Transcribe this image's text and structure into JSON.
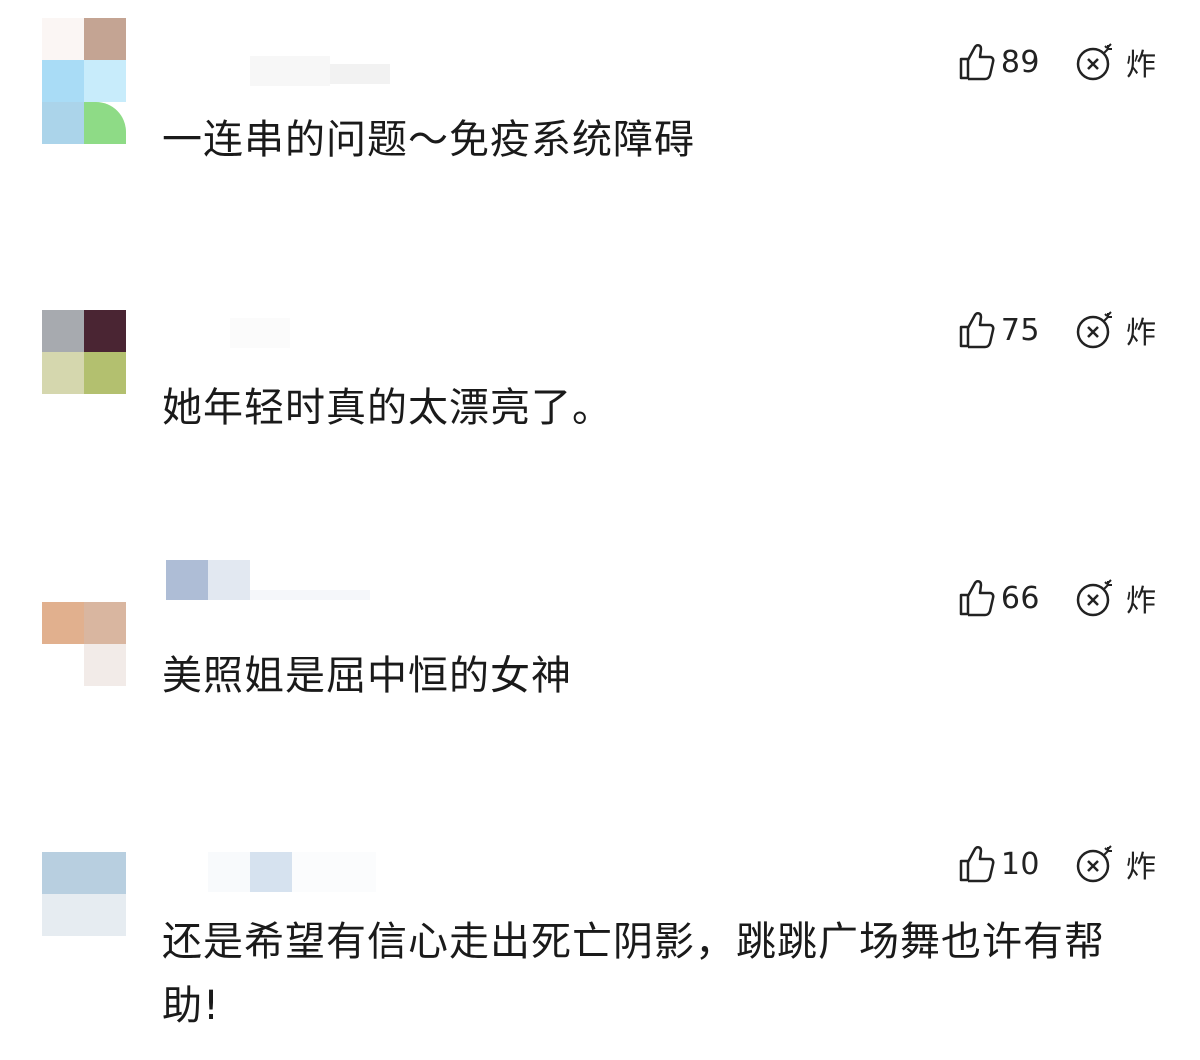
{
  "comments": [
    {
      "text": "一连串的问题～免疫系统障碍",
      "likes": "89",
      "bomb_label": "炸",
      "avatar_colors": [
        "#fbf6f4",
        "#c4a493",
        "#a9dcf6",
        "#c8ecfb",
        "#abd4ea",
        "#8edb86"
      ]
    },
    {
      "text": "她年轻时真的太漂亮了。",
      "likes": "75",
      "bomb_label": "炸",
      "avatar_colors": [
        "#a7aaaf",
        "#4a2533",
        "#d5d7ae",
        "#b3c06f"
      ]
    },
    {
      "text": "美照姐是屈中恒的女神",
      "likes": "66",
      "bomb_label": "炸",
      "avatar_colors": [
        "#e1b08e",
        "#d9b6a0",
        "#ffffff",
        "#f2ebe8"
      ]
    },
    {
      "text": "还是希望有信心走出死亡阴影，跳跳广场舞也许有帮助!",
      "likes": "10",
      "bomb_label": "炸",
      "avatar_colors": [
        "#b8cfe0",
        "#b8cfe0",
        "#e6ecf1",
        "#e6ecf1"
      ]
    }
  ],
  "icons": {
    "like": "thumbs-up-icon",
    "bomb": "bomb-icon"
  },
  "colors": {
    "text": "#1a1a1a",
    "icon": "#222222",
    "background": "#ffffff"
  }
}
